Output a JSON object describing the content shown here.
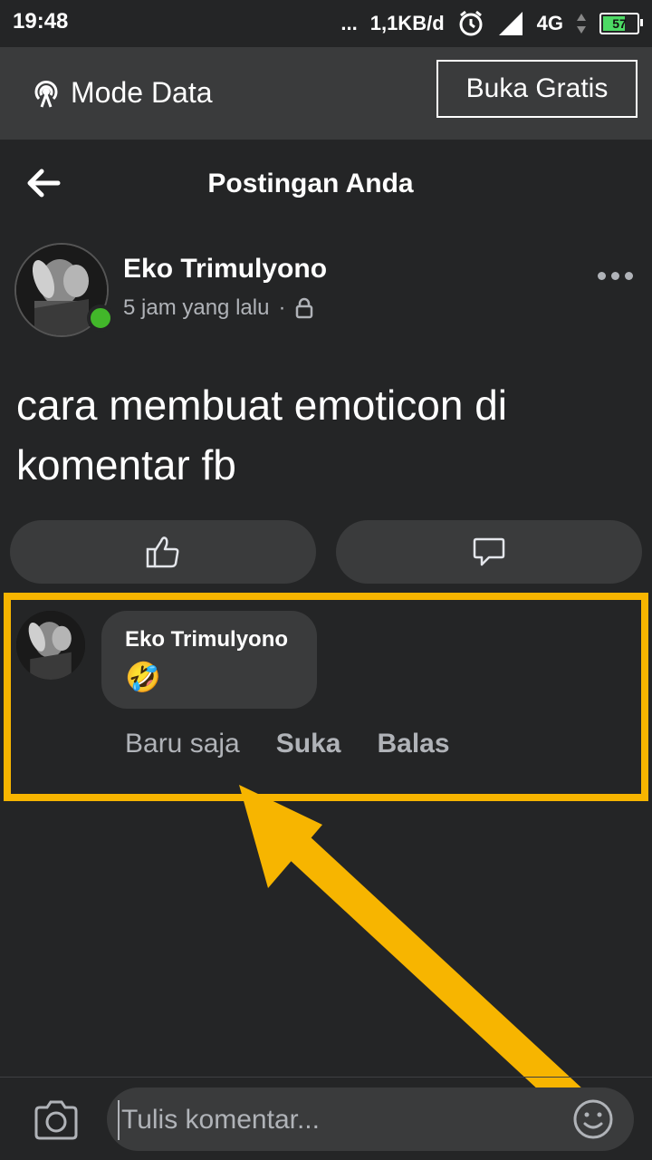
{
  "status_bar": {
    "time": "19:48",
    "dots": "...",
    "speed": "1,1KB/d",
    "network": "4G",
    "battery": "57"
  },
  "mode_bar": {
    "label": "Mode Data",
    "button": "Buka Gratis"
  },
  "header": {
    "title": "Postingan Anda"
  },
  "post": {
    "author": "Eko Trimulyono",
    "time": "5 jam yang lalu",
    "separator": "·",
    "text": "cara membuat emoticon di komentar fb"
  },
  "comment": {
    "author": "Eko Trimulyono",
    "emoji": "🤣",
    "time": "Baru saja",
    "like": "Suka",
    "reply": "Balas"
  },
  "composer": {
    "placeholder": "Tulis komentar..."
  },
  "colors": {
    "background": "#242526",
    "surface": "#3a3b3c",
    "highlight": "#f7b500",
    "online": "#42b72a"
  },
  "icons": [
    "radio-tower-icon",
    "alarm-icon",
    "signal-icon",
    "battery-icon",
    "back-arrow-icon",
    "lock-icon",
    "more-icon",
    "like-icon",
    "comment-icon",
    "camera-icon",
    "smiley-icon",
    "pointer-arrow"
  ]
}
